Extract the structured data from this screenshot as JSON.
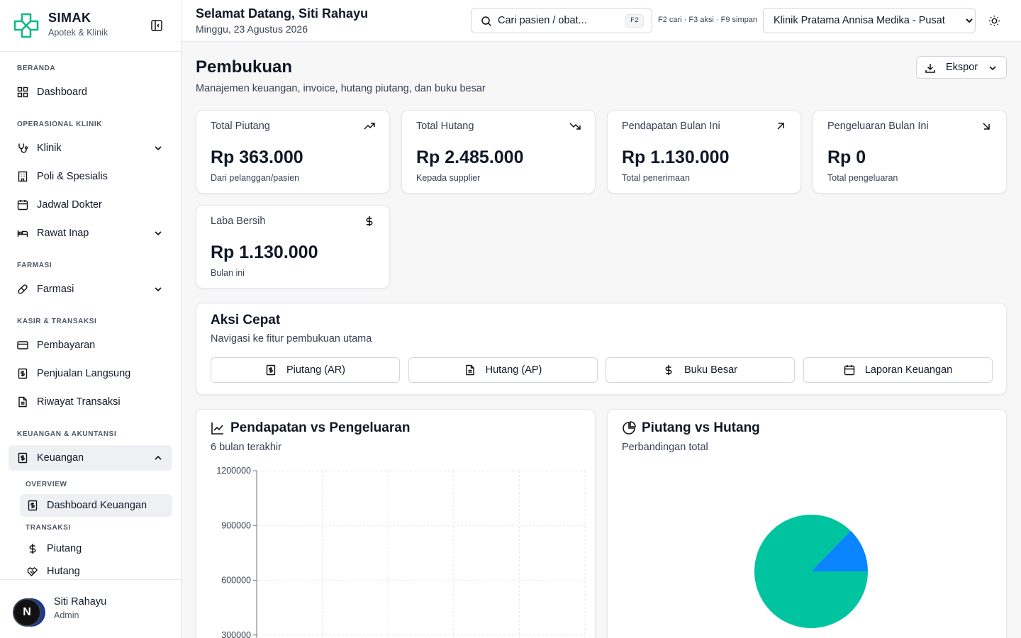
{
  "brand": {
    "name": "SIMAK",
    "subtitle": "Apotek & Klinik"
  },
  "sidebar": {
    "sections": {
      "beranda": "BERANDA",
      "operasional": "OPERASIONAL KLINIK",
      "farmasi": "FARMASI",
      "kasir": "KASIR & TRANSAKSI",
      "keuangan": "KEUANGAN & AKUNTANSI"
    },
    "items": {
      "dashboard": "Dashboard",
      "klinik": "Klinik",
      "poli": "Poli & Spesialis",
      "jadwal": "Jadwal Dokter",
      "rawat_inap": "Rawat Inap",
      "farmasi": "Farmasi",
      "pembayaran": "Pembayaran",
      "penjualan": "Penjualan Langsung",
      "riwayat": "Riwayat Transaksi",
      "keuangan": "Keuangan"
    },
    "sub_sections": {
      "overview": "OVERVIEW",
      "transaksi": "TRANSAKSI"
    },
    "sub_items": {
      "dashboard_keuangan": "Dashboard Keuangan",
      "piutang": "Piutang",
      "hutang": "Hutang"
    }
  },
  "user": {
    "initial": "N",
    "name": "Siti Rahayu",
    "role": "Admin"
  },
  "header": {
    "welcome": "Selamat Datang, Siti Rahayu",
    "date": "Minggu, 23 Agustus 2026",
    "search_placeholder": "Cari pasien / obat...",
    "search_key": "F2",
    "shortcuts": "F2 cari · F3 aksi · F9 simpan",
    "clinic": "Klinik Pratama Annisa Medika - Pusat"
  },
  "page": {
    "title": "Pembukuan",
    "subtitle": "Manajemen keuangan, invoice, hutang piutang, dan buku besar",
    "export_label": "Ekspor"
  },
  "stats": [
    {
      "title": "Total Piutang",
      "value": "Rp 363.000",
      "desc": "Dari pelanggan/pasien"
    },
    {
      "title": "Total Hutang",
      "value": "Rp 2.485.000",
      "desc": "Kepada supplier"
    },
    {
      "title": "Pendapatan Bulan Ini",
      "value": "Rp 1.130.000",
      "desc": "Total penerimaan"
    },
    {
      "title": "Pengeluaran Bulan Ini",
      "value": "Rp 0",
      "desc": "Total pengeluaran"
    },
    {
      "title": "Laba Bersih",
      "value": "Rp 1.130.000",
      "desc": "Bulan ini"
    }
  ],
  "quick": {
    "title": "Aksi Cepat",
    "subtitle": "Navigasi ke fitur pembukuan utama",
    "buttons": [
      "Piutang (AR)",
      "Hutang (AP)",
      "Buku Besar",
      "Laporan Keuangan"
    ]
  },
  "charts": {
    "line": {
      "title": "Pendapatan vs Pengeluaran",
      "subtitle": "6 bulan terakhir"
    },
    "pie": {
      "title": "Piutang vs Hutang",
      "subtitle": "Perbandingan total"
    }
  },
  "chart_data": [
    {
      "type": "line",
      "title": "Pendapatan vs Pengeluaran",
      "yticks": [
        1200000,
        900000,
        600000,
        300000
      ],
      "ylim": [
        0,
        1200000
      ],
      "grid": true,
      "series": []
    },
    {
      "type": "pie",
      "title": "Piutang vs Hutang",
      "slices": [
        {
          "value": 363000,
          "color": "#0a84ff"
        },
        {
          "value": 2485000,
          "color": "#00c49f"
        }
      ]
    }
  ]
}
